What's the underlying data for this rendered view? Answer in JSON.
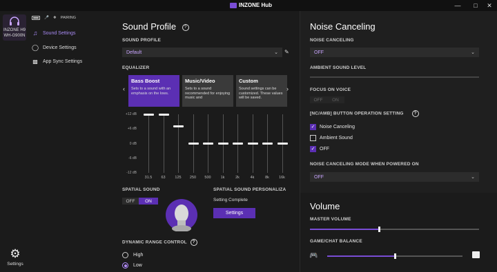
{
  "titlebar": {
    "title": "INZONE Hub",
    "minimize_icon": "minimize-icon",
    "maximize_icon": "maximize-icon",
    "close_icon": "close-icon"
  },
  "device": {
    "name_line1": "INZONE H9",
    "name_line2": "WH-G900N",
    "pairing_label": "PAIRING"
  },
  "sidebar": {
    "items": [
      {
        "label": "Sound Settings",
        "icon": "music-note-icon",
        "active": true
      },
      {
        "label": "Device Settings",
        "icon": "headphones-icon",
        "active": false
      },
      {
        "label": "App Sync Settings",
        "icon": "grid-icon",
        "active": false
      }
    ],
    "settings_label": "Settings"
  },
  "sound_profile": {
    "title": "Sound Profile",
    "section_label": "SOUND PROFILE",
    "selected": "Default",
    "equalizer_label": "EQUALIZER",
    "presets": [
      {
        "title": "Bass Boost",
        "desc": "Sets to a sound with an emphasis on the lows."
      },
      {
        "title": "Music/Video",
        "desc": "Sets to a sound recommended for enjoying music and"
      },
      {
        "title": "Custom",
        "desc": "Sound settings can be customized. These values will be saved."
      }
    ],
    "eq": {
      "ticks": [
        "+12 dB",
        "+6 dB",
        "0 dB",
        "-6 dB",
        "-12 dB"
      ],
      "bands": [
        "31.5",
        "63",
        "125",
        "250",
        "500",
        "1k",
        "2k",
        "4k",
        "8k",
        "16k"
      ],
      "values_db": [
        12,
        12,
        7,
        0,
        0,
        0,
        0,
        0,
        0,
        0
      ]
    },
    "spatial_sound_label": "SPATIAL SOUND",
    "spatial_off": "OFF",
    "spatial_on": "ON",
    "spatial_personalize_label": "SPATIAL SOUND PERSONALIZA",
    "setting_complete": "Setting Complete",
    "settings_button": "Settings",
    "dynamic_range_label": "DYNAMIC RANGE CONTROL",
    "dr_high": "High",
    "dr_low": "Low"
  },
  "noise": {
    "title": "Noise Canceling",
    "nc_label": "NOISE CANCELING",
    "nc_value": "OFF",
    "ambient_label": "AMBIENT SOUND LEVEL",
    "focus_label": "FOCUS ON VOICE",
    "focus_off": "OFF",
    "focus_on": "ON",
    "button_setting_label": "[NC/AMB] BUTTON OPERATION SETTING",
    "options": [
      {
        "label": "Noise Canceling",
        "checked": true
      },
      {
        "label": "Ambient Sound",
        "checked": false
      },
      {
        "label": "OFF",
        "checked": true
      }
    ],
    "powered_on_label": "NOISE CANCELING MODE WHEN POWERED ON",
    "powered_on_value": "OFF"
  },
  "volume": {
    "title": "Volume",
    "master_label": "MASTER VOLUME",
    "master_level": 0.41,
    "balance_label": "GAME/CHAT BALANCE",
    "balance_level": 0.5
  },
  "colors": {
    "accent": "#5b2fb3",
    "accent_text": "#b48cff",
    "bg": "#1b1b1b"
  }
}
